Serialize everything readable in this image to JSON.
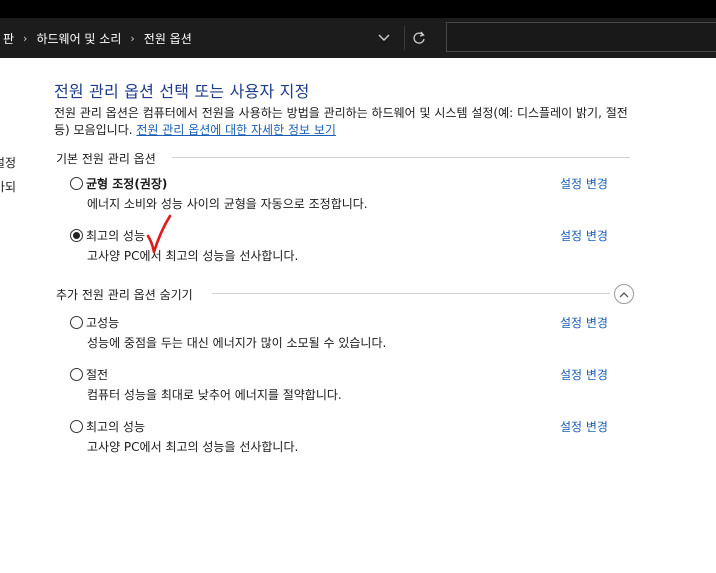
{
  "breadcrumb": {
    "items": [
      "판",
      "하드웨어 및 소리",
      "전원 옵션"
    ],
    "separator": "›"
  },
  "nav_pane_cut": [
    "설정",
    "가되"
  ],
  "title": "전원 관리 옵션 선택 또는 사용자 지정",
  "description": {
    "text": "전원 관리 옵션은 컴퓨터에서 전원을 사용하는 방법을 관리하는 하드웨어 및 시스템 설정(예: 디스플레이 밝기, 절전 등) 모음입니다.",
    "link": "전원 관리 옵션에 대한 자세한 정보 보기"
  },
  "basic_section": {
    "header": "기본 전원 관리 옵션",
    "plans": [
      {
        "name": "균형 조정(권장)",
        "description": "에너지 소비와 성능 사이의 균형을 자동으로 조정합니다.",
        "selected": false,
        "bold": true,
        "change": "설정 변경"
      },
      {
        "name": "최고의 성능",
        "description": "고사양 PC에서 최고의 성능을 선사합니다.",
        "selected": true,
        "bold": false,
        "change": "설정 변경"
      }
    ]
  },
  "extra_section": {
    "header": "추가 전원 관리 옵션 숨기기",
    "plans": [
      {
        "name": "고성능",
        "description": "성능에 중점을 두는 대신 에너지가 많이 소모될 수 있습니다.",
        "selected": false,
        "change": "설정 변경"
      },
      {
        "name": "절전",
        "description": "컴퓨터 성능을 최대로 낮추어 에너지를 절약합니다.",
        "selected": false,
        "change": "설정 변경"
      },
      {
        "name": "최고의 성능",
        "description": "고사양 PC에서 최고의 성능을 선사합니다.",
        "selected": false,
        "change": "설정 변경"
      }
    ]
  },
  "annotation_color": "#e01b1b",
  "icons": {
    "dropdown": "chevron-down-icon",
    "refresh": "refresh-icon",
    "collapse": "chevron-up-circle-icon"
  }
}
